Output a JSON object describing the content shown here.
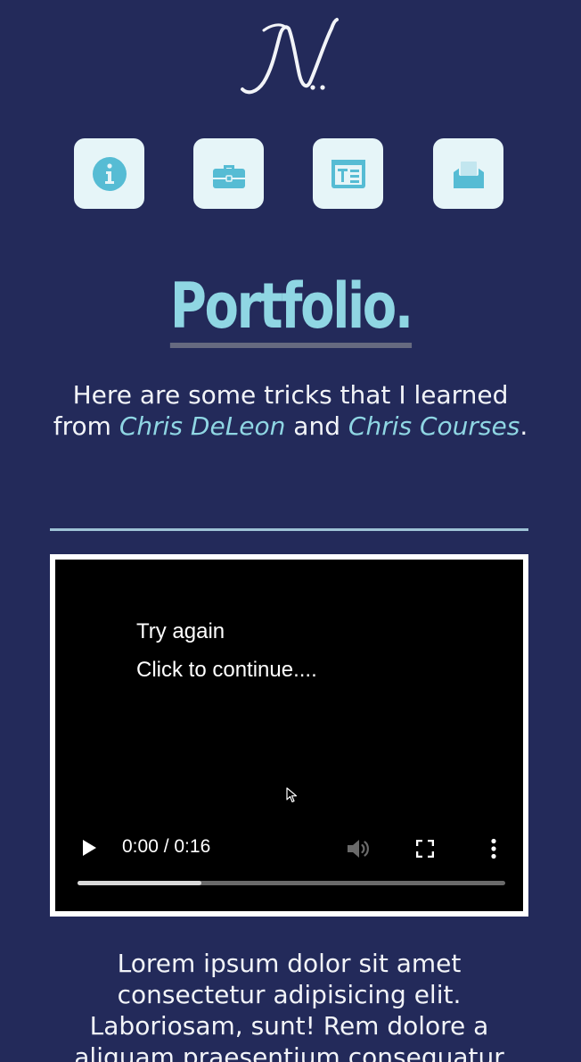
{
  "logo": {
    "letter": "N",
    "dots": ".."
  },
  "nav": {
    "items": [
      {
        "icon": "info-icon",
        "label": "About"
      },
      {
        "icon": "briefcase-icon",
        "label": "Work"
      },
      {
        "icon": "text-card-icon",
        "label": "Blog"
      },
      {
        "icon": "envelope-icon",
        "label": "Contact"
      }
    ]
  },
  "colors": {
    "background": "#232a5a",
    "accent": "#8fd6e3",
    "icon_tile": "#e6f5f8",
    "icon": "#56bcd4",
    "text": "#f2f4f8",
    "divider": "#9ec3d6"
  },
  "page_title": "Portfolio.",
  "intro": {
    "text_1": "Here are some tricks that I learned from ",
    "link_1": "Chris DeLeon",
    "text_2": " and ",
    "link_2": "Chris Courses",
    "text_3": "."
  },
  "video": {
    "overlay_line_1": "Try again",
    "overlay_line_2": "Click to continue....",
    "time": "0:00 / 0:16",
    "progress": 0.29
  },
  "body_text": "Lorem ipsum dolor sit amet consectetur adipisicing elit. Laboriosam, sunt! Rem dolore a aliquam praesentium consequatur"
}
